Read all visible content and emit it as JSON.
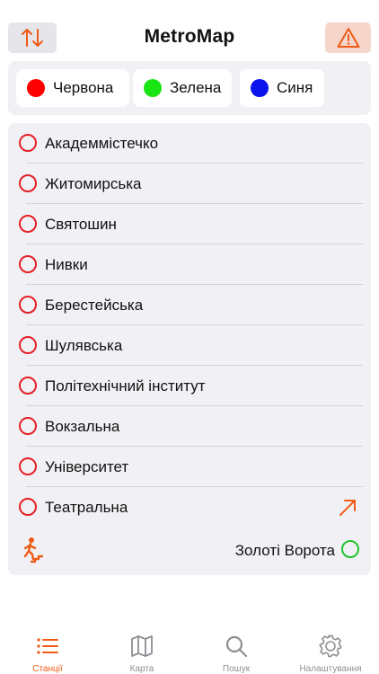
{
  "header": {
    "title": "MetroMap",
    "sort_icon": "sort-arrows-icon",
    "alert_icon": "warning-triangle-icon",
    "accent_color": "#f05a16"
  },
  "lines": [
    {
      "label": "Червона",
      "color": "#ff0000"
    },
    {
      "label": "Зелена",
      "color": "#18e512"
    },
    {
      "label": "Синя",
      "color": "#0a12ee"
    }
  ],
  "stations": [
    {
      "name": "Академмістечко"
    },
    {
      "name": "Житомирська"
    },
    {
      "name": "Святошин"
    },
    {
      "name": "Нивки"
    },
    {
      "name": "Берестейська"
    },
    {
      "name": "Шулявська"
    },
    {
      "name": "Політехнічний інститут"
    },
    {
      "name": "Вокзальна"
    },
    {
      "name": "Університет"
    },
    {
      "name": "Театральна",
      "transfer_icon": "arrow-up-right-icon"
    }
  ],
  "transfer": {
    "station": "Золоті Ворота",
    "icon": "walking-stairs-icon",
    "line_color": "#22c32e"
  },
  "tabs": [
    {
      "label": "Станції",
      "icon": "list-icon",
      "active": true
    },
    {
      "label": "Карта",
      "icon": "map-icon",
      "active": false
    },
    {
      "label": "Пошук",
      "icon": "search-icon",
      "active": false
    },
    {
      "label": "Налаштування",
      "icon": "gear-icon",
      "active": false
    }
  ]
}
